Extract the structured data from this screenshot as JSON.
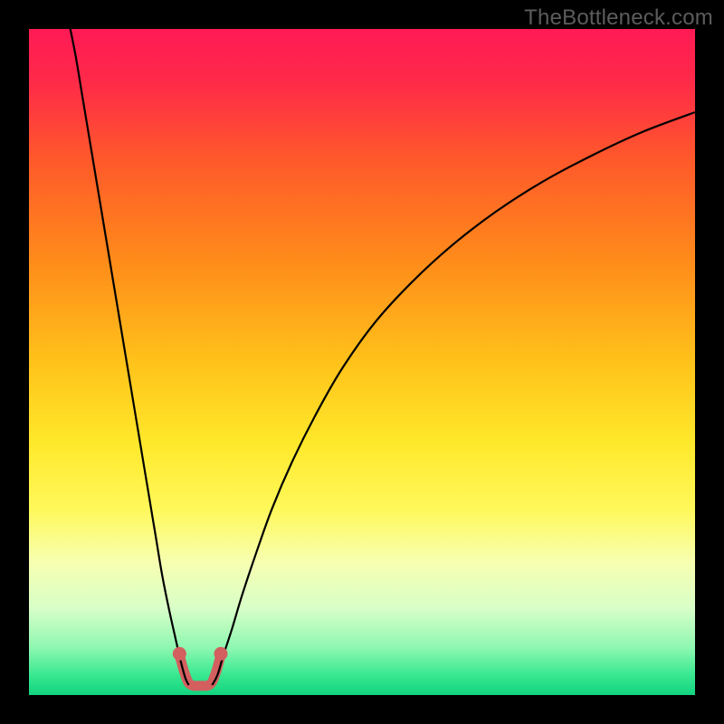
{
  "watermark": "TheBottleneck.com",
  "chart_data": {
    "type": "line",
    "title": "",
    "xlabel": "",
    "ylabel": "",
    "xlim": [
      0,
      100
    ],
    "ylim": [
      0,
      100
    ],
    "gradient_stops": [
      {
        "offset": 0.0,
        "color": "#ff1a55"
      },
      {
        "offset": 0.08,
        "color": "#ff2a48"
      },
      {
        "offset": 0.2,
        "color": "#ff5a2a"
      },
      {
        "offset": 0.35,
        "color": "#ff8c1a"
      },
      {
        "offset": 0.5,
        "color": "#ffc21a"
      },
      {
        "offset": 0.62,
        "color": "#ffe82a"
      },
      {
        "offset": 0.72,
        "color": "#fff85a"
      },
      {
        "offset": 0.8,
        "color": "#f7ffb0"
      },
      {
        "offset": 0.87,
        "color": "#d8ffc8"
      },
      {
        "offset": 0.93,
        "color": "#8cf7b0"
      },
      {
        "offset": 0.97,
        "color": "#38e890"
      },
      {
        "offset": 1.0,
        "color": "#12d37f"
      }
    ],
    "series": [
      {
        "name": "left-curve",
        "type": "line",
        "color": "#000000",
        "width": 2.2,
        "points": [
          {
            "x": 6.0,
            "y": 101.0
          },
          {
            "x": 7.0,
            "y": 96.0
          },
          {
            "x": 8.0,
            "y": 90.0
          },
          {
            "x": 9.0,
            "y": 84.0
          },
          {
            "x": 10.0,
            "y": 78.0
          },
          {
            "x": 11.0,
            "y": 72.0
          },
          {
            "x": 12.0,
            "y": 66.0
          },
          {
            "x": 13.0,
            "y": 60.0
          },
          {
            "x": 14.0,
            "y": 54.0
          },
          {
            "x": 15.0,
            "y": 48.0
          },
          {
            "x": 16.0,
            "y": 42.0
          },
          {
            "x": 17.0,
            "y": 36.0
          },
          {
            "x": 18.0,
            "y": 30.0
          },
          {
            "x": 19.0,
            "y": 24.0
          },
          {
            "x": 20.0,
            "y": 18.0
          },
          {
            "x": 21.0,
            "y": 13.0
          },
          {
            "x": 22.0,
            "y": 8.5
          },
          {
            "x": 22.8,
            "y": 5.0
          },
          {
            "x": 23.5,
            "y": 2.5
          },
          {
            "x": 24.0,
            "y": 1.5
          }
        ]
      },
      {
        "name": "right-curve",
        "type": "line",
        "color": "#000000",
        "width": 2.2,
        "points": [
          {
            "x": 27.5,
            "y": 1.5
          },
          {
            "x": 28.3,
            "y": 3.0
          },
          {
            "x": 29.2,
            "y": 6.0
          },
          {
            "x": 30.5,
            "y": 10.0
          },
          {
            "x": 32.0,
            "y": 15.0
          },
          {
            "x": 34.0,
            "y": 21.0
          },
          {
            "x": 36.5,
            "y": 28.0
          },
          {
            "x": 39.5,
            "y": 35.0
          },
          {
            "x": 43.0,
            "y": 42.0
          },
          {
            "x": 47.0,
            "y": 49.0
          },
          {
            "x": 52.0,
            "y": 56.0
          },
          {
            "x": 57.5,
            "y": 62.0
          },
          {
            "x": 63.5,
            "y": 67.5
          },
          {
            "x": 70.0,
            "y": 72.5
          },
          {
            "x": 77.0,
            "y": 77.0
          },
          {
            "x": 84.5,
            "y": 81.0
          },
          {
            "x": 92.0,
            "y": 84.5
          },
          {
            "x": 100.0,
            "y": 87.5
          }
        ]
      },
      {
        "name": "highlight-bottom",
        "type": "line",
        "color": "#d35f5f",
        "width": 11,
        "cap": "round",
        "points": [
          {
            "x": 22.6,
            "y": 6.0
          },
          {
            "x": 23.4,
            "y": 3.2
          },
          {
            "x": 24.2,
            "y": 1.6
          },
          {
            "x": 25.8,
            "y": 1.4
          },
          {
            "x": 27.2,
            "y": 1.6
          },
          {
            "x": 28.0,
            "y": 3.2
          },
          {
            "x": 28.8,
            "y": 6.0
          }
        ]
      }
    ],
    "highlight_dots": {
      "color": "#d35f5f",
      "radius": 7.5,
      "points": [
        {
          "x": 22.6,
          "y": 6.2
        },
        {
          "x": 28.8,
          "y": 6.2
        }
      ]
    }
  }
}
